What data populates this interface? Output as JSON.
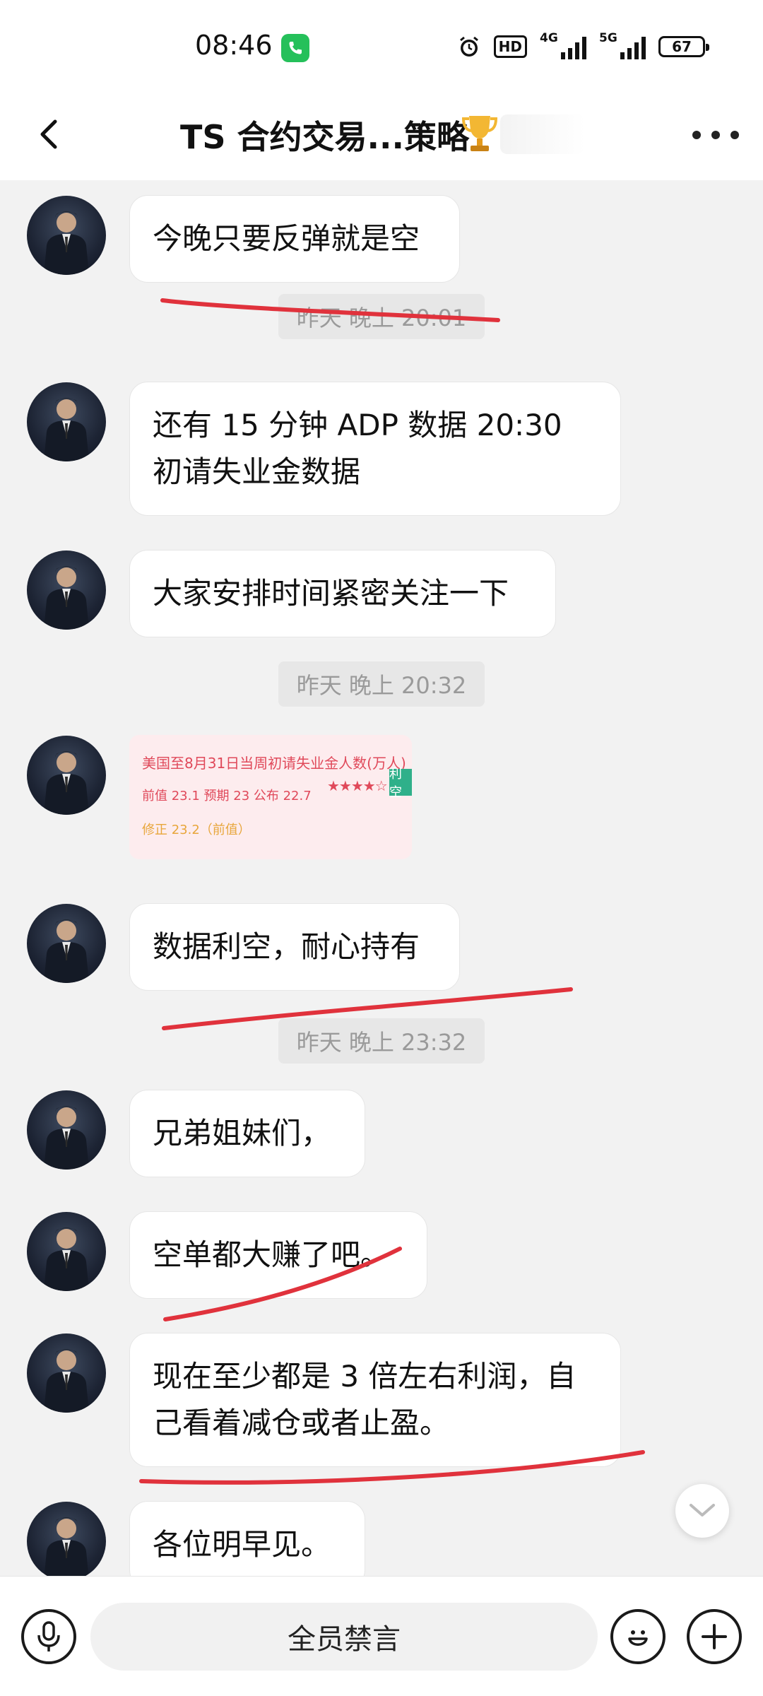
{
  "status_bar": {
    "time": "08:46",
    "hd_label": "HD",
    "net1": "4G",
    "net2": "5G",
    "battery": "67"
  },
  "header": {
    "title": "TS 合约交易...策略"
  },
  "messages": [
    {
      "text": "今晚只要反弹就是空"
    },
    {
      "text": "还有 15 分钟 ADP 数据  20:30 初请失业金数据"
    },
    {
      "text": "大家安排时间紧密关注一下"
    },
    {
      "text": "数据利空，耐心持有"
    },
    {
      "text": "兄弟姐妹们，"
    },
    {
      "text": "空单都大赚了吧。"
    },
    {
      "text": "现在至少都是 3 倍左右利润，自己看着减仓或者止盈。"
    },
    {
      "text": "各位明早见。"
    }
  ],
  "timestamps": [
    "昨天 晚上 20:01",
    "昨天 晚上 20:32",
    "昨天 晚上 23:32"
  ],
  "data_card": {
    "title": "美国至8月31日当周初请失业金人数(万人)",
    "values": "前值 23.1   预期 23   公布 22.7",
    "revised": "修正 23.2（前值）",
    "stars": "★★★★☆",
    "badge": "利空"
  },
  "input_bar": {
    "muted_text": "全员禁言"
  }
}
